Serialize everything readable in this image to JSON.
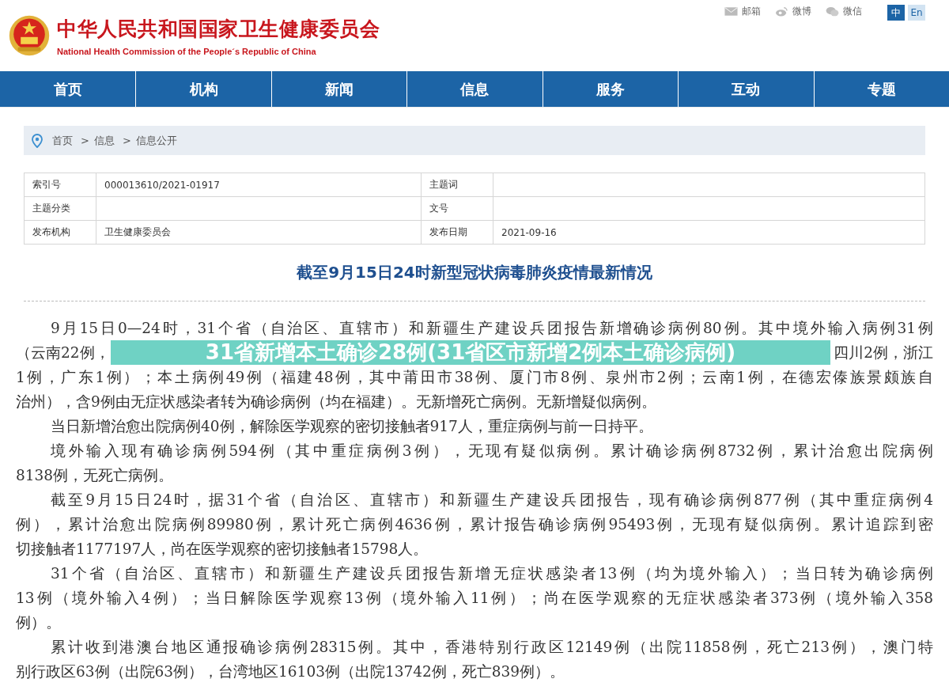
{
  "header": {
    "title": "中华人民共和国国家卫生健康委员会",
    "subtitle": "National Health Commission of the People´s Republic of China",
    "links": [
      {
        "label": "邮箱"
      },
      {
        "label": "微博"
      },
      {
        "label": "微信"
      }
    ],
    "languages": [
      {
        "label": "中",
        "selected": true
      },
      {
        "label": "En",
        "selected": false
      }
    ]
  },
  "nav": [
    {
      "label": "首页"
    },
    {
      "label": "机构"
    },
    {
      "label": "新闻"
    },
    {
      "label": "信息"
    },
    {
      "label": "服务"
    },
    {
      "label": "互动"
    },
    {
      "label": "专题"
    }
  ],
  "breadcrumb": [
    "首页",
    "信息",
    "信息公开"
  ],
  "breadcrumb_separator": ">",
  "info_table": [
    [
      {
        "label": "索引号",
        "value": "000013610/2021-01917"
      },
      {
        "label": "主题词"
      }
    ],
    [
      {
        "label": "主题分类"
      },
      {
        "label": "文号"
      }
    ],
    [
      {
        "label": "发布机构",
        "value": "卫生健康委员会"
      },
      {
        "label": "发布日期",
        "value": "2021-09-16"
      }
    ]
  ],
  "article_title": "截至9月15日24时新型冠状病毒肺炎疫情最新情况",
  "overlay_banner": "31省新增本土确诊28例(31省区市新增2例本土确诊病例)",
  "paragraphs": [
    {
      "lines": [
        {
          "kind": "full",
          "text": "9月15日0—24时，31个省（自治区、直辖市）和新疆生产建设兵团报告新增确诊病例80例。其中境外输入病例31例"
        },
        {
          "kind": "split",
          "parts": [
            "（云南22例，",
            "四川2例，浙江"
          ]
        },
        {
          "kind": "full",
          "text": "1例，广东1例）；本土病例49例（福建48例，其中莆田市38例、厦门市8例、泉州市2例；云南1例，在德宏傣族景颇族自"
        },
        {
          "kind": "last",
          "text": "治州），含9例由无症状感染者转为确诊病例（均在福建）。无新增死亡病例。无新增疑似病例。"
        }
      ]
    },
    {
      "lines": [
        {
          "kind": "last",
          "text": "当日新增治愈出院病例40例，解除医学观察的密切接触者917人，重症病例与前一日持平。"
        }
      ]
    },
    {
      "lines": [
        {
          "kind": "full",
          "text": "境外输入现有确诊病例594例（其中重症病例3例），无现有疑似病例。累计确诊病例8732例，累计治愈出院病例"
        },
        {
          "kind": "last",
          "text": "8138例，无死亡病例。"
        }
      ]
    },
    {
      "lines": [
        {
          "kind": "full",
          "text": "截至9月15日24时，据31个省（自治区、直辖市）和新疆生产建设兵团报告，现有确诊病例877例（其中重症病例4"
        },
        {
          "kind": "full",
          "text": "例），累计治愈出院病例89980例，累计死亡病例4636例，累计报告确诊病例95493例，无现有疑似病例。累计追踪到密"
        },
        {
          "kind": "last",
          "text": "切接触者1177197人，尚在医学观察的密切接触者15798人。"
        }
      ]
    },
    {
      "lines": [
        {
          "kind": "full",
          "text": "31个省（自治区、直辖市）和新疆生产建设兵团报告新增无症状感染者13例（均为境外输入）；当日转为确诊病例"
        },
        {
          "kind": "full",
          "text": "13例（境外输入4例）；当日解除医学观察13例（境外输入11例）；尚在医学观察的无症状感染者373例（境外输入358"
        },
        {
          "kind": "last",
          "text": "例）。"
        }
      ]
    },
    {
      "lines": [
        {
          "kind": "full",
          "text": "累计收到港澳台地区通报确诊病例28315例。其中，香港特别行政区12149例（出院11858例，死亡213例），澳门特"
        },
        {
          "kind": "last",
          "text": "别行政区63例（出院63例），台湾地区16103例（出院13742例，死亡839例）。"
        }
      ]
    }
  ]
}
